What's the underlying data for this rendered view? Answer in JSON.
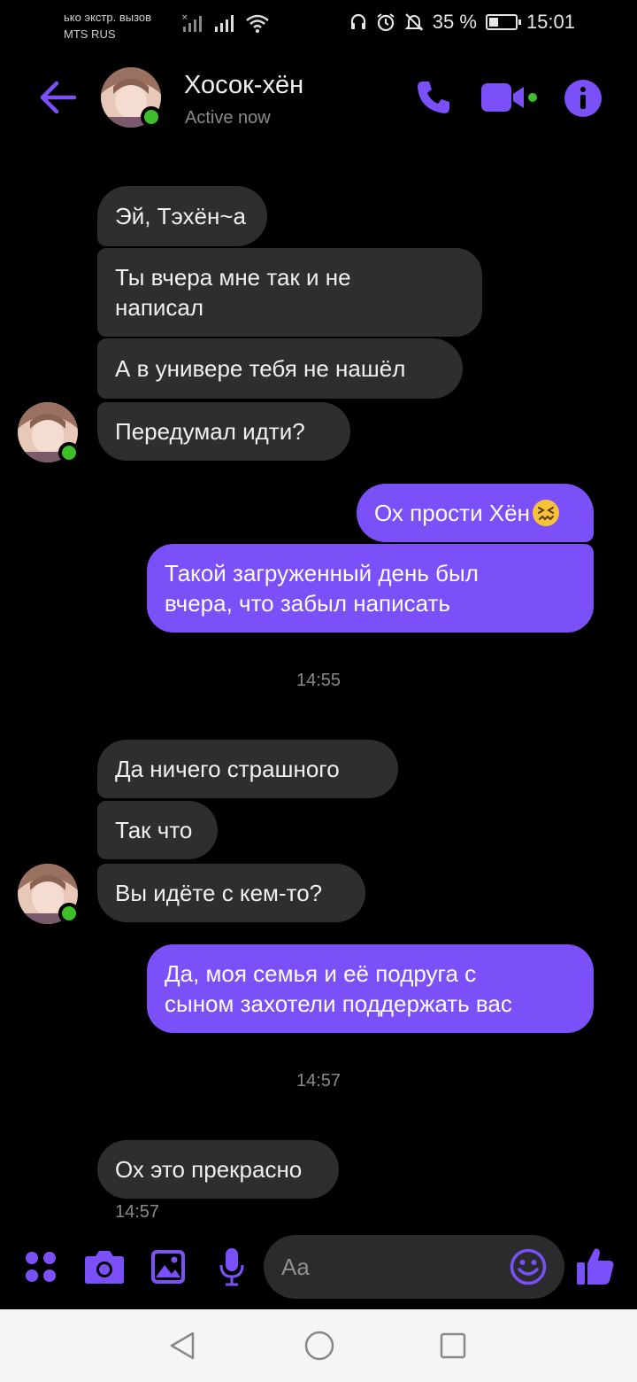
{
  "status_bar": {
    "carrier_line1": "ько экстр. вызов",
    "carrier_line2": "MTS RUS",
    "battery_percent": "35 %",
    "time": "15:01"
  },
  "header": {
    "contact_name": "Хосок-хён",
    "contact_status": "Active now"
  },
  "colors": {
    "accent": "#7b50f8",
    "incoming_bubble": "#2e2e30",
    "online": "#3fbe2c",
    "background": "#000000"
  },
  "messages": [
    {
      "dir": "in",
      "text": "Эй, Тэхён~а"
    },
    {
      "dir": "in",
      "text": "Ты вчера мне так и не\nнаписал"
    },
    {
      "dir": "in",
      "text": "А в универе тебя не нашёл"
    },
    {
      "dir": "in",
      "text": "Передумал идти?"
    },
    {
      "dir": "out",
      "text": "Ох прости Хён",
      "emoji": "confounded-face"
    },
    {
      "dir": "out",
      "text": "Такой загруженный день был\nвчера, что забыл написать"
    },
    {
      "dir": "time",
      "text": "14:55"
    },
    {
      "dir": "in",
      "text": "Да ничего страшного"
    },
    {
      "dir": "in",
      "text": "Так что"
    },
    {
      "dir": "in",
      "text": "Вы идёте с кем-то?"
    },
    {
      "dir": "out",
      "text": "Да, моя семья и её подруга с\nсыном захотели поддержать вас"
    },
    {
      "dir": "time",
      "text": "14:57"
    },
    {
      "dir": "in",
      "text": "Ох это прекрасно"
    },
    {
      "dir": "meta",
      "text": "14:57"
    }
  ],
  "composer": {
    "placeholder": "Aa",
    "icons": [
      "apps-icon",
      "camera-icon",
      "gallery-icon",
      "microphone-icon",
      "emoji-icon",
      "thumbs-up-icon"
    ]
  },
  "navigation_bar": {
    "icons": [
      "back-triangle-icon",
      "home-circle-icon",
      "recents-square-icon"
    ]
  }
}
